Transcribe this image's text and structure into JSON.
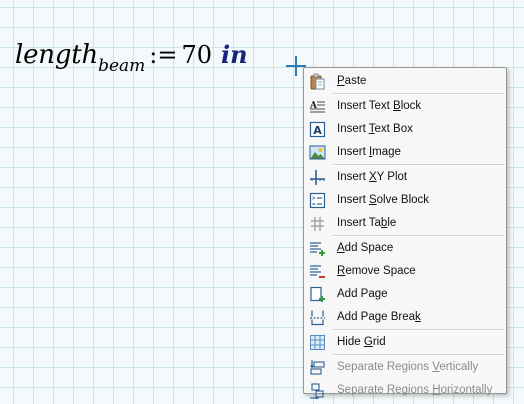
{
  "math": {
    "variable": "length",
    "subscript": "beam",
    "define_operator": ":=",
    "value": "70",
    "unit": "in"
  },
  "context_menu": {
    "items": [
      {
        "before": "",
        "mnemonic": "P",
        "after": "aste",
        "icon": "clipboard-icon",
        "disabled": false
      },
      {
        "before": "Insert Text ",
        "mnemonic": "B",
        "after": "lock",
        "icon": "text-block-icon",
        "disabled": false
      },
      {
        "before": "Insert ",
        "mnemonic": "T",
        "after": "ext Box",
        "icon": "text-box-icon",
        "disabled": false
      },
      {
        "before": "Insert ",
        "mnemonic": "I",
        "after": "mage",
        "icon": "image-icon",
        "disabled": false
      },
      {
        "before": "Insert ",
        "mnemonic": "X",
        "after": "Y Plot",
        "icon": "xy-plot-icon",
        "disabled": false
      },
      {
        "before": "Insert ",
        "mnemonic": "S",
        "after": "olve Block",
        "icon": "solve-block-icon",
        "disabled": false
      },
      {
        "before": "Insert Ta",
        "mnemonic": "b",
        "after": "le",
        "icon": "table-icon",
        "disabled": false
      },
      {
        "before": "",
        "mnemonic": "A",
        "after": "dd Space",
        "icon": "add-space-icon",
        "disabled": false
      },
      {
        "before": "",
        "mnemonic": "R",
        "after": "emove Space",
        "icon": "remove-space-icon",
        "disabled": false
      },
      {
        "before": "Add Pa",
        "mnemonic": "g",
        "after": "e",
        "icon": "add-page-icon",
        "disabled": false
      },
      {
        "before": "Add Page Brea",
        "mnemonic": "k",
        "after": "",
        "icon": "page-break-icon",
        "disabled": false
      },
      {
        "before": "Hide ",
        "mnemonic": "G",
        "after": "rid",
        "icon": "grid-icon",
        "disabled": false
      },
      {
        "before": "Separate Regions ",
        "mnemonic": "V",
        "after": "ertically",
        "icon": "separate-vertical-icon",
        "disabled": true
      },
      {
        "before": "Separate Regions ",
        "mnemonic": "H",
        "after": "orizontally",
        "icon": "separate-horizontal-icon",
        "disabled": true
      }
    ]
  },
  "colors": {
    "unit": "#1a237e",
    "cursor": "#2a7ab0",
    "icon_blue": "#2c5f96",
    "icon_green": "#2e9a3a",
    "icon_red": "#c0392b",
    "grid_line": "#cfe3ea",
    "menu_background": "#f7f7f7"
  }
}
